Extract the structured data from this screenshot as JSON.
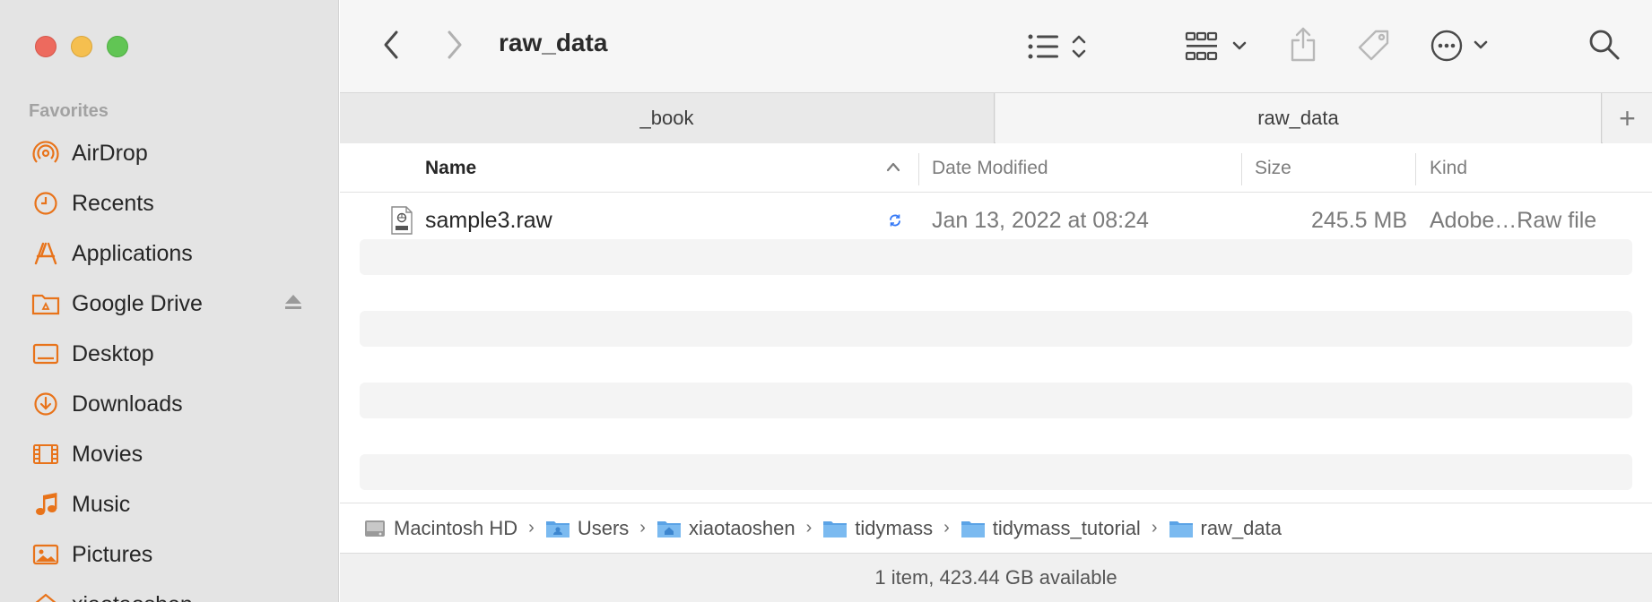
{
  "window": {
    "title": "raw_data"
  },
  "sidebar": {
    "header": "Favorites",
    "items": [
      {
        "label": "AirDrop",
        "icon": "airdrop-icon"
      },
      {
        "label": "Recents",
        "icon": "clock-icon"
      },
      {
        "label": "Applications",
        "icon": "applications-icon"
      },
      {
        "label": "Google Drive",
        "icon": "google-drive-folder-icon",
        "eject": "eject-icon"
      },
      {
        "label": "Desktop",
        "icon": "desktop-icon"
      },
      {
        "label": "Downloads",
        "icon": "downloads-icon"
      },
      {
        "label": "Movies",
        "icon": "film-icon"
      },
      {
        "label": "Music",
        "icon": "music-note-icon"
      },
      {
        "label": "Pictures",
        "icon": "picture-icon"
      },
      {
        "label": "xiaotaoshen",
        "icon": "home-icon"
      }
    ]
  },
  "tabs": [
    {
      "label": "_book"
    },
    {
      "label": "raw_data"
    }
  ],
  "tab_add_label": "+",
  "columns": {
    "name": "Name",
    "date": "Date Modified",
    "size": "Size",
    "kind": "Kind"
  },
  "files": [
    {
      "name": "sample3.raw",
      "date": "Jan 13, 2022 at 08:24",
      "size": "245.5 MB",
      "kind": "Adobe…Raw file"
    }
  ],
  "path": [
    {
      "label": "Macintosh HD",
      "icon": "hard-drive-icon"
    },
    {
      "label": "Users",
      "icon": "users-folder-icon"
    },
    {
      "label": "xiaotaoshen",
      "icon": "home-folder-icon"
    },
    {
      "label": "tidymass",
      "icon": "folder-icon"
    },
    {
      "label": "tidymass_tutorial",
      "icon": "folder-icon"
    },
    {
      "label": "raw_data",
      "icon": "folder-icon"
    }
  ],
  "path_separator": "›",
  "status": "1 item, 423.44 GB available",
  "colors": {
    "accent": "#e8731a",
    "folder_blue": "#5ba3e6",
    "sync_blue": "#3478f6"
  }
}
